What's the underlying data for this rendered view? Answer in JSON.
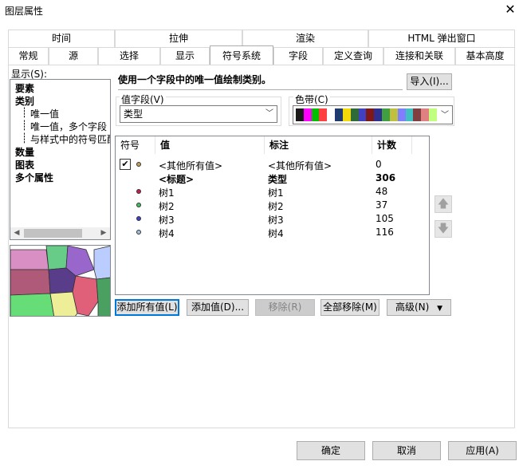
{
  "window": {
    "title": "图层属性",
    "close_glyph": "✕"
  },
  "tabs_row1": [
    {
      "label": "时间"
    },
    {
      "label": "拉伸"
    },
    {
      "label": "渲染"
    },
    {
      "label": "HTML 弹出窗口"
    }
  ],
  "tabs_row2": [
    {
      "label": "常规"
    },
    {
      "label": "源"
    },
    {
      "label": "选择"
    },
    {
      "label": "显示"
    },
    {
      "label": "符号系统",
      "active": true
    },
    {
      "label": "字段"
    },
    {
      "label": "定义查询"
    },
    {
      "label": "连接和关联"
    },
    {
      "label": "基本高度"
    }
  ],
  "show": {
    "label": "显示(S):",
    "tree": [
      {
        "label": "要素",
        "bold": true
      },
      {
        "label": "类别",
        "bold": true
      },
      {
        "label": "唯一值",
        "bold": false
      },
      {
        "label": "唯一值，多个字段",
        "bold": false
      },
      {
        "label": "与样式中的符号匹配",
        "bold": false
      },
      {
        "label": "数量",
        "bold": true
      },
      {
        "label": "图表",
        "bold": true
      },
      {
        "label": "多个属性",
        "bold": true
      }
    ]
  },
  "description": "使用一个字段中的唯一值绘制类别。",
  "import_button": "导入(I)...",
  "value_field": {
    "label": "值字段(V)",
    "selected": "类型"
  },
  "color_ramp": {
    "label": "色带(C)",
    "colors": [
      "#1a1a1a",
      "#ff00ff",
      "#00c000",
      "#ff4040",
      "#ffffff",
      "#1f3a6e",
      "#f5d80a",
      "#2f6b36",
      "#4040c0",
      "#801818",
      "#2f2f90",
      "#40a040",
      "#c0c040",
      "#8080ff",
      "#40c0c0",
      "#804040",
      "#e08080",
      "#c0ff80"
    ]
  },
  "table": {
    "headers": [
      "符号",
      "值",
      "标注",
      "计数"
    ],
    "rows": [
      {
        "checked": true,
        "dot": "#c0a060",
        "value": "<其他所有值>",
        "label": "<其他所有值>",
        "count": "0",
        "bold": false
      },
      {
        "checked": false,
        "dot": "",
        "value": "<标题>",
        "label": "类型",
        "count": "306",
        "bold": true
      },
      {
        "checked": false,
        "dot": "#c02050",
        "value": "树1",
        "label": "树1",
        "count": "48",
        "bold": false
      },
      {
        "checked": false,
        "dot": "#40c060",
        "value": "树2",
        "label": "树2",
        "count": "37",
        "bold": false
      },
      {
        "checked": false,
        "dot": "#4040c0",
        "value": "树3",
        "label": "树3",
        "count": "105",
        "bold": false
      },
      {
        "checked": false,
        "dot": "#a0c0e0",
        "value": "树4",
        "label": "树4",
        "count": "116",
        "bold": false
      }
    ]
  },
  "action_buttons": {
    "add_all": "添加所有值(L)",
    "add": "添加值(D)...",
    "remove": "移除(R)",
    "remove_all": "全部移除(M)",
    "advanced": "高级(N)"
  },
  "footer": {
    "ok": "确定",
    "cancel": "取消",
    "apply": "应用(A)"
  },
  "icons": {
    "up": "arrow-up-icon",
    "down": "arrow-down-icon",
    "check": "checkmark-icon",
    "chevron": "chevron-down-icon"
  }
}
